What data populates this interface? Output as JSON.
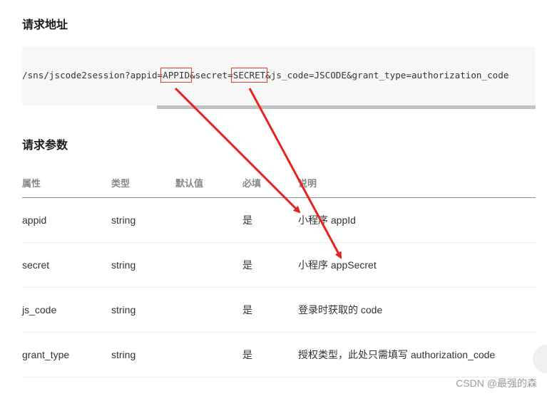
{
  "sections": {
    "request_url_title": "请求地址",
    "request_params_title": "请求参数"
  },
  "code": {
    "prefix": "/sns/jscode2session?appid=",
    "appid": "APPID",
    "middle": "&secret=",
    "secret": "SECRET",
    "suffix": "&js_code=JSCODE&grant_type=authorization_code"
  },
  "table": {
    "headers": [
      "属性",
      "类型",
      "默认值",
      "必填",
      "说明"
    ],
    "rows": [
      {
        "name": "appid",
        "type": "string",
        "default": "",
        "required": "是",
        "desc": "小程序 appId"
      },
      {
        "name": "secret",
        "type": "string",
        "default": "",
        "required": "是",
        "desc": "小程序 appSecret"
      },
      {
        "name": "js_code",
        "type": "string",
        "default": "",
        "required": "是",
        "desc": "登录时获取的 code"
      },
      {
        "name": "grant_type",
        "type": "string",
        "default": "",
        "required": "是",
        "desc": "授权类型，此处只需填写 authorization_code"
      }
    ]
  },
  "watermark": "CSDN @最强的森",
  "colors": {
    "annotation_red": "#e8231b",
    "header_text": "#888888",
    "code_bg": "#f7f7f7"
  }
}
